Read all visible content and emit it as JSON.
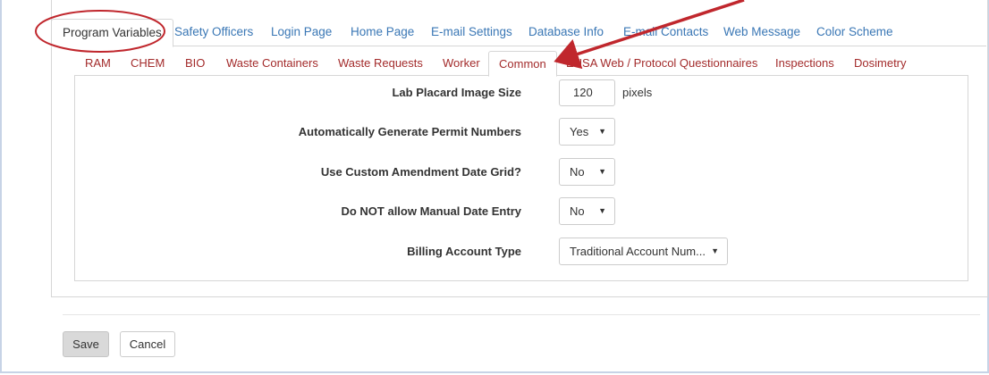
{
  "top_tabs": [
    {
      "label": "Program Variables",
      "active": true
    },
    {
      "label": "Safety Officers"
    },
    {
      "label": "Login Page"
    },
    {
      "label": "Home Page"
    },
    {
      "label": "E-mail Settings"
    },
    {
      "label": "Database Info"
    },
    {
      "label": "E-mail Contacts"
    },
    {
      "label": "Web Message"
    },
    {
      "label": "Color Scheme"
    }
  ],
  "sub_tabs": [
    {
      "label": "RAM"
    },
    {
      "label": "CHEM"
    },
    {
      "label": "BIO"
    },
    {
      "label": "Waste Containers"
    },
    {
      "label": "Waste Requests"
    },
    {
      "label": "Worker"
    },
    {
      "label": "Common",
      "active": true
    },
    {
      "label": "EHSA Web / Protocol Questionnaires"
    },
    {
      "label": "Inspections"
    },
    {
      "label": "Dosimetry"
    }
  ],
  "fields": {
    "lab_placard": {
      "label": "Lab Placard Image Size",
      "value": "120",
      "unit": "pixels"
    },
    "auto_permit": {
      "label": "Automatically Generate Permit Numbers",
      "value": "Yes"
    },
    "custom_amendment": {
      "label": "Use Custom Amendment Date Grid?",
      "value": "No"
    },
    "no_manual_date": {
      "label": "Do NOT allow Manual Date Entry",
      "value": "No"
    },
    "billing_account": {
      "label": "Billing Account Type",
      "value": "Traditional Account Num..."
    }
  },
  "buttons": {
    "save": "Save",
    "cancel": "Cancel"
  },
  "colors": {
    "link": "#3a77b5",
    "subtab": "#a32b2b",
    "annotation": "#c0272d"
  },
  "icons": {
    "caret": "caret-down-icon"
  }
}
